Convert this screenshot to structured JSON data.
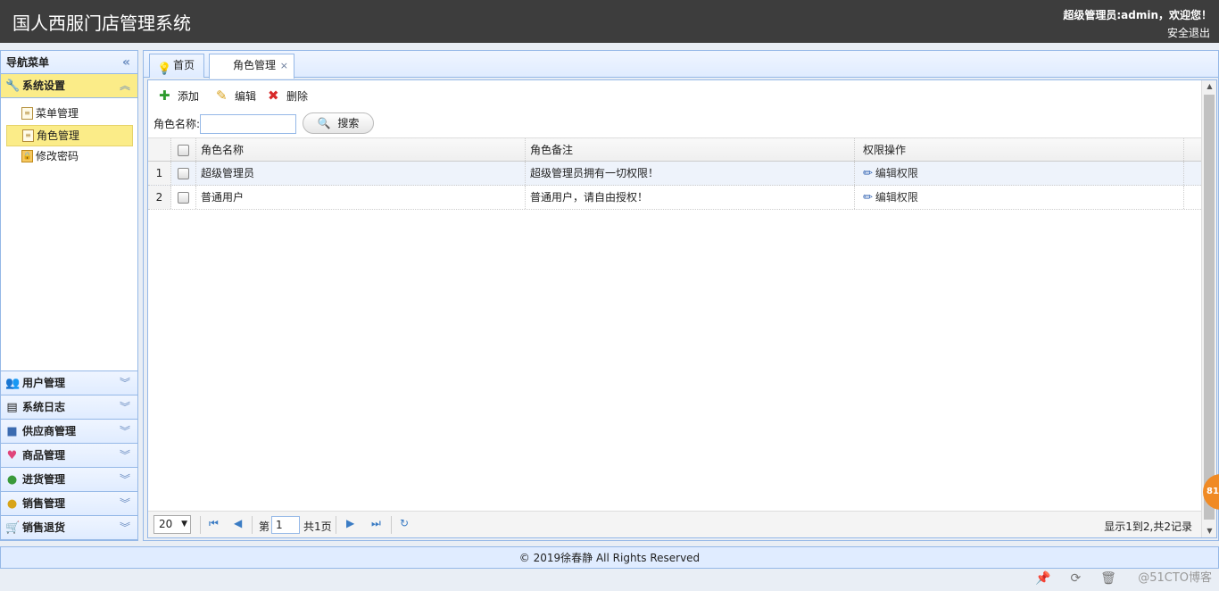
{
  "header": {
    "title": "国人西服门店管理系统",
    "welcome": "超级管理员:admin，欢迎您！",
    "logout": "安全退出"
  },
  "nav": {
    "title": "导航菜单",
    "collapse_glyph": "«",
    "active_panel": {
      "label": "系统设置",
      "items": [
        {
          "label": "菜单管理"
        },
        {
          "label": "角色管理"
        },
        {
          "label": "修改密码"
        }
      ]
    },
    "panels": [
      {
        "label": "用户管理",
        "icon": "users-icon"
      },
      {
        "label": "系统日志",
        "icon": "log-icon"
      },
      {
        "label": "供应商管理",
        "icon": "supplier-icon"
      },
      {
        "label": "商品管理",
        "icon": "heart-icon"
      },
      {
        "label": "进货管理",
        "icon": "globe-icon"
      },
      {
        "label": "销售管理",
        "icon": "coins-icon"
      },
      {
        "label": "销售退货",
        "icon": "cart-icon"
      }
    ]
  },
  "tabs": [
    {
      "label": "首页"
    },
    {
      "label": "角色管理",
      "close": "×"
    }
  ],
  "toolbar": {
    "add": "添加",
    "edit": "编辑",
    "delete": "删除"
  },
  "search": {
    "label": "角色名称:",
    "value": "",
    "button": "搜索"
  },
  "grid": {
    "headers": {
      "name": "角色名称",
      "note": "角色备注",
      "perm": "权限操作"
    },
    "rows": [
      {
        "num": "1",
        "name": "超级管理员",
        "note": "超级管理员拥有一切权限！",
        "perm": "编辑权限"
      },
      {
        "num": "2",
        "name": "普通用户",
        "note": "普通用户，请自由授权！",
        "perm": "编辑权限"
      }
    ]
  },
  "pager": {
    "page_size": "20",
    "page_prefix": "第",
    "page_value": "1",
    "page_total": "共1页",
    "info": "显示1到2,共2记录"
  },
  "footer": {
    "text": "© 2019徐春静 All Rights Reserved"
  },
  "badge": "81",
  "watermark": "@51CTO博客"
}
